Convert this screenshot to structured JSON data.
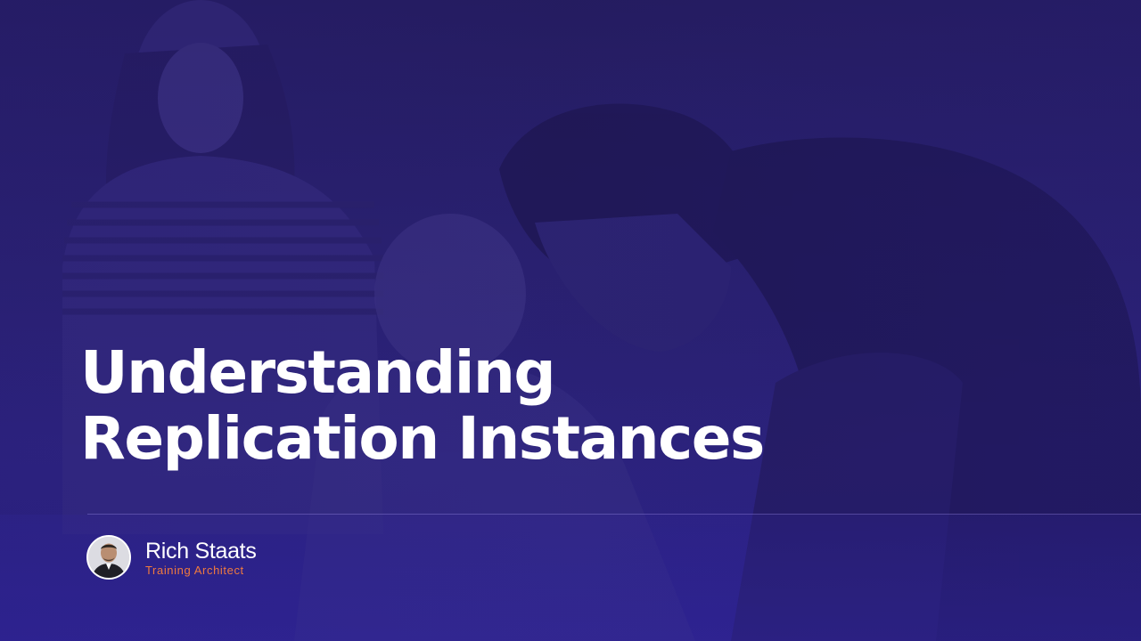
{
  "slide": {
    "title_line_1": "Understanding",
    "title_line_2": "Replication Instances"
  },
  "presenter": {
    "name": "Rich Staats",
    "role": "Training Architect",
    "avatar_icon": "person-avatar-icon"
  },
  "colors": {
    "overlay_tint": "#2a2270",
    "title_text": "#ffffff",
    "role_text": "#f07a3e",
    "divider": "#8c7ddc"
  }
}
